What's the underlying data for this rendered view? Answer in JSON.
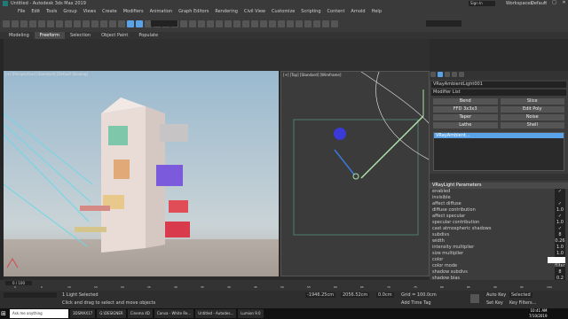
{
  "window": {
    "title": "Untitled - Autodesk 3ds Max 2019",
    "search_placeholder": "Sign In",
    "workspace_label": "Workspaces:",
    "workspace_value": "Default"
  },
  "menu": [
    "File",
    "Edit",
    "Tools",
    "Group",
    "Views",
    "Create",
    "Modifiers",
    "Animation",
    "Graph Editors",
    "Rendering",
    "Civil View",
    "Customize",
    "Scripting",
    "Content",
    "Arnold",
    "Help"
  ],
  "ribbon_tabs": [
    "Modeling",
    "Freeform",
    "Selection",
    "Object Paint",
    "Populate"
  ],
  "viewports": {
    "perspective_label": "[+] [Perspective] [Standard] [Default Shading]",
    "top_label": "[+] [Top] [Standard] [Wireframe]"
  },
  "command_panel": {
    "object_name": "VRayAmbientLight001",
    "modifier_list": "Modifier List",
    "buttons": [
      "Bend",
      "Slice",
      "FFD 3x3x3",
      "Edit Poly",
      "Taper",
      "Noise",
      "Lathe",
      "Shell"
    ],
    "stack_item": "VRayAmbient...",
    "rollout_title": "VRayLight Parameters",
    "params": [
      {
        "label": "enabled",
        "value": "✓"
      },
      {
        "label": "invisible",
        "value": ""
      },
      {
        "label": "affect diffuse",
        "value": "✓"
      },
      {
        "label": "diffuse contribution",
        "value": "1.0"
      },
      {
        "label": "affect specular",
        "value": "✓"
      },
      {
        "label": "specular contribution",
        "value": "1.0"
      },
      {
        "label": "cast atmospheric shadows",
        "value": "✓"
      },
      {
        "label": "subdivs",
        "value": "8"
      },
      {
        "label": "width",
        "value": "0.26"
      },
      {
        "label": "intensity multiplier",
        "value": "1.0"
      },
      {
        "label": "size multiplier",
        "value": "1.0"
      },
      {
        "label": "color",
        "value": ""
      },
      {
        "label": "color mode",
        "value": "filter"
      },
      {
        "label": "shadow subdivs",
        "value": "8"
      },
      {
        "label": "shadow bias",
        "value": "0.2"
      },
      {
        "label": "photon emit radius",
        "value": "50.0cm"
      }
    ]
  },
  "timeline": {
    "frame_display": "0 / 100",
    "ticks": [
      "0",
      "5",
      "10",
      "15",
      "20",
      "25",
      "30",
      "35",
      "40",
      "45",
      "50",
      "55",
      "60",
      "65",
      "70",
      "75",
      "80",
      "85",
      "90",
      "95",
      "100"
    ]
  },
  "status": {
    "left_text": "1 Light Selected",
    "hint_text": "Click and drag to select and move objects",
    "x_value": "-1946.25cm",
    "y_value": "2056.52cm",
    "z_value": "0.0cm",
    "grid": "Grid = 100.0cm",
    "add_time_tag": "Add Time Tag",
    "autokey": "Auto Key",
    "selected": "Selected",
    "set_key": "Set Key",
    "key_filters": "Key Filters..."
  },
  "taskbar": {
    "items": [
      "Ask me anything",
      "3DSMAX17",
      "G:\\DESIGNER",
      "Cinema 4D",
      "Canva - White Re...",
      "Untitled - Autodes...",
      "Lumion 9.0"
    ],
    "time": "10:41 AM",
    "date": "7/10/2019"
  },
  "colors": {
    "accent": "#4a90d9",
    "selection": "#5ba3e8",
    "panel": "#3c3c3c",
    "viewport_bg": "#3b3b3b"
  }
}
